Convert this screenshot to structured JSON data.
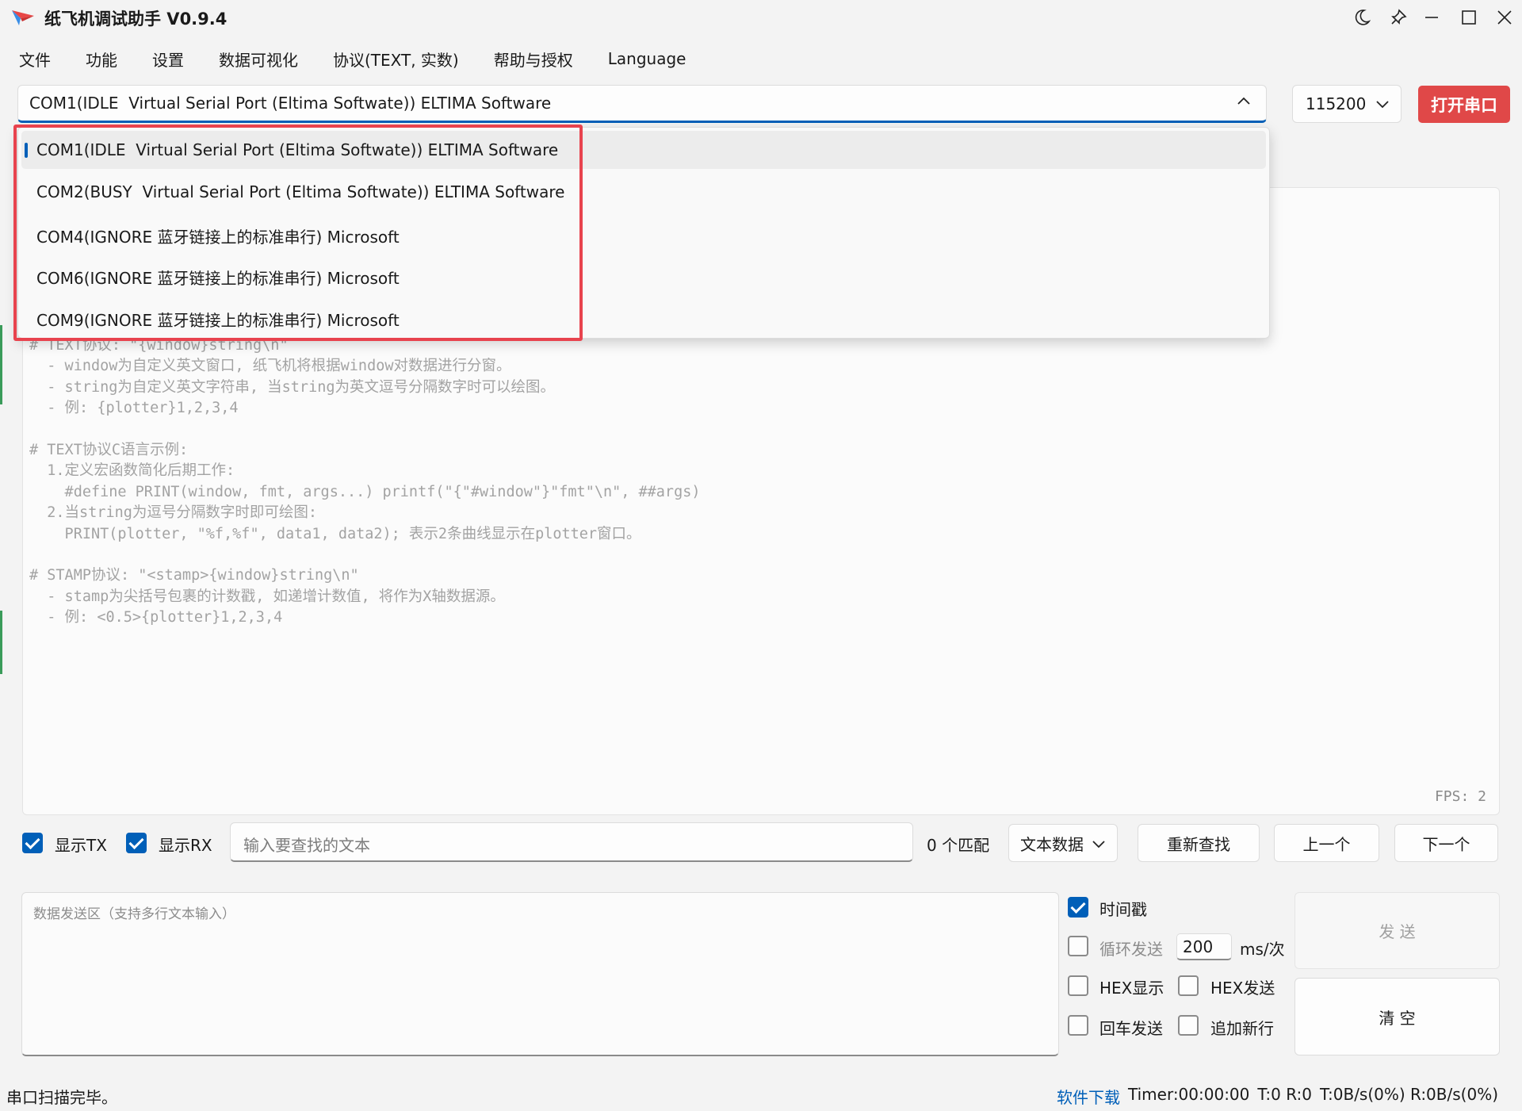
{
  "app": {
    "title": "纸飞机调试助手 V0.9.4",
    "window_icons": [
      "moon-icon",
      "pin-icon",
      "minimize-icon",
      "maximize-icon",
      "close-icon"
    ]
  },
  "menu": [
    "文件",
    "功能",
    "设置",
    "数据可视化",
    "协议(TEXT, 实数)",
    "帮助与授权",
    "Language"
  ],
  "port": {
    "selected": "COM1(IDLE  Virtual Serial Port (Eltima Softwate)) ELTIMA Software",
    "options": [
      "COM1(IDLE  Virtual Serial Port (Eltima Softwate)) ELTIMA Software",
      "COM2(BUSY  Virtual Serial Port (Eltima Softwate)) ELTIMA Software",
      "COM4(IGNORE 蓝牙链接上的标准串行) Microsoft",
      "COM6(IGNORE 蓝牙链接上的标准串行) Microsoft",
      "COM9(IGNORE 蓝牙链接上的标准串行) Microsoft"
    ]
  },
  "baud": {
    "value": "115200"
  },
  "open_port_label": "打开串口",
  "receive": {
    "placeholder_text": "# TEXT协议: \"{window}string\\n\"\n  - window为自定义英文窗口, 纸飞机将根据window对数据进行分窗。\n  - string为自定义英文字符串, 当string为英文逗号分隔数字时可以绘图。\n  - 例: {plotter}1,2,3,4\n\n# TEXT协议C语言示例:\n  1.定义宏函数简化后期工作:\n    #define PRINT(window, fmt, args...) printf(\"{\"#window\"}\"fmt\"\\n\", ##args)\n  2.当string为逗号分隔数字时即可绘图:\n    PRINT(plotter, \"%f,%f\", data1, data2); 表示2条曲线显示在plotter窗口。\n\n# STAMP协议: \"<stamp>{window}string\\n\"\n  - stamp为尖括号包裹的计数戳, 如递增计数值, 将作为X轴数据源。\n  - 例: <0.5>{plotter}1,2,3,4",
    "fps": "FPS: 2"
  },
  "search": {
    "show_tx": {
      "label": "显示TX",
      "checked": true
    },
    "show_rx": {
      "label": "显示RX",
      "checked": true
    },
    "placeholder": "输入要查找的文本",
    "match_count": "0 个匹配",
    "mode": "文本数据",
    "refind": "重新查找",
    "prev": "上一个",
    "next": "下一个"
  },
  "send": {
    "placeholder": "数据发送区（支持多行文本输入）",
    "timestamp": {
      "label": "时间戳",
      "checked": true
    },
    "loop_send": {
      "label": "循环发送",
      "checked": false
    },
    "interval": "200",
    "interval_unit": "ms/次",
    "hex_display": {
      "label": "HEX显示",
      "checked": false
    },
    "hex_send": {
      "label": "HEX发送",
      "checked": false
    },
    "enter_send": {
      "label": "回车发送",
      "checked": false
    },
    "append_newline": {
      "label": "追加新行",
      "checked": false
    },
    "send_label": "发 送",
    "clear_label": "清 空"
  },
  "status": {
    "message": "串口扫描完毕。",
    "download": "软件下载",
    "timer": "Timer:00:00:00",
    "tr_counts": "T:0 R:0",
    "rates": "T:0B/s(0%) R:0B/s(0%)"
  },
  "colors": {
    "accent": "#005fb8",
    "danger": "#e04848",
    "highlight_box": "#e8434e"
  }
}
